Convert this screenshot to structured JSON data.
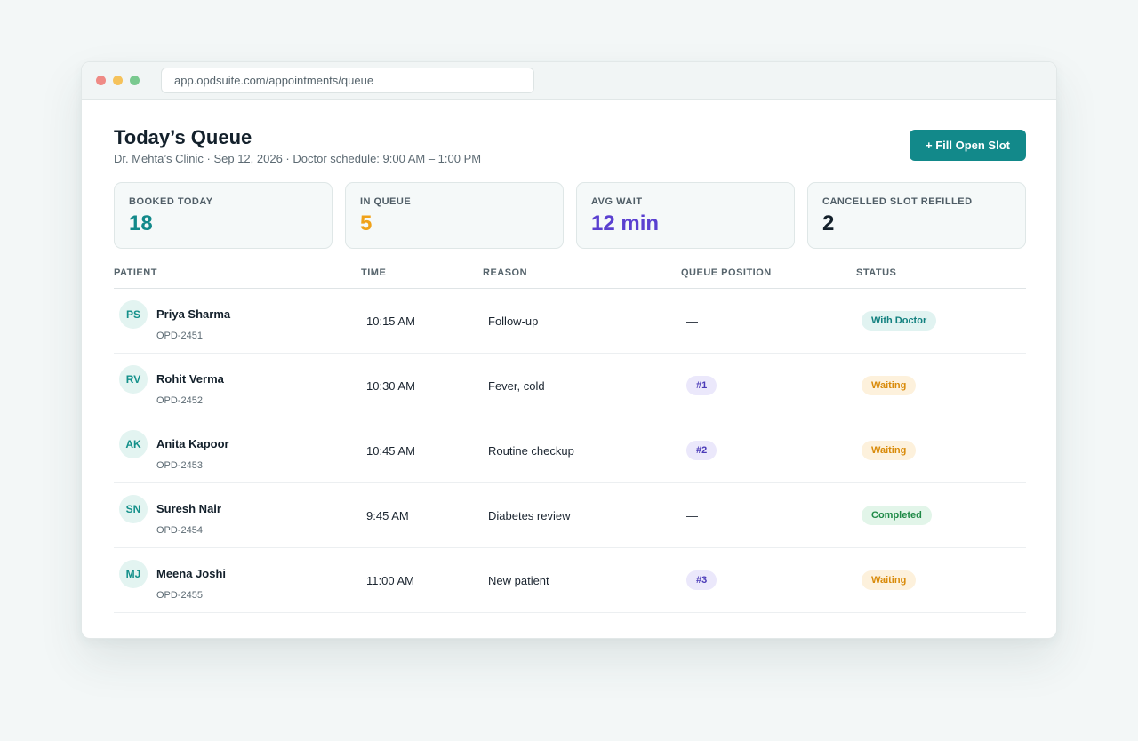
{
  "browser": {
    "url": "app.opdsuite.com/appointments/queue"
  },
  "header": {
    "title": "Today’s Queue",
    "subtitle": "Dr. Mehta’s Clinic · Sep 12, 2026 · Doctor schedule: 9:00 AM – 1:00 PM",
    "fill_button_label": "+ Fill Open Slot"
  },
  "stats": [
    {
      "label": "BOOKED TODAY",
      "value": "18",
      "color": "#12898a"
    },
    {
      "label": "IN QUEUE",
      "value": "5",
      "color": "#f0a21a"
    },
    {
      "label": "AVG WAIT",
      "value": "12 min",
      "color": "#5a40d0"
    },
    {
      "label": "CANCELLED SLOT REFILLED",
      "value": "2",
      "color": "#13202b"
    }
  ],
  "table": {
    "columns": [
      "PATIENT",
      "TIME",
      "REASON",
      "QUEUE POSITION",
      "STATUS"
    ],
    "rows": [
      {
        "initials": "PS",
        "name": "Priya Sharma",
        "id": "OPD-2451",
        "time": "10:15 AM",
        "reason": "Follow-up",
        "queue": "—",
        "status": "With Doctor"
      },
      {
        "initials": "RV",
        "name": "Rohit Verma",
        "id": "OPD-2452",
        "time": "10:30 AM",
        "reason": "Fever, cold",
        "queue": "#1",
        "status": "Waiting"
      },
      {
        "initials": "AK",
        "name": "Anita Kapoor",
        "id": "OPD-2453",
        "time": "10:45 AM",
        "reason": "Routine checkup",
        "queue": "#2",
        "status": "Waiting"
      },
      {
        "initials": "SN",
        "name": "Suresh Nair",
        "id": "OPD-2454",
        "time": "9:45 AM",
        "reason": "Diabetes review",
        "queue": "—",
        "status": "Completed"
      },
      {
        "initials": "MJ",
        "name": "Meena Joshi",
        "id": "OPD-2455",
        "time": "11:00 AM",
        "reason": "New patient",
        "queue": "#3",
        "status": "Waiting"
      }
    ]
  },
  "status_colors": {
    "With Doctor": {
      "bg": "#e1f3f1",
      "fg": "#12807f"
    },
    "Waiting": {
      "bg": "#fdf1dc",
      "fg": "#d98b0a"
    },
    "Completed": {
      "bg": "#e2f5e9",
      "fg": "#1f8a47"
    }
  }
}
